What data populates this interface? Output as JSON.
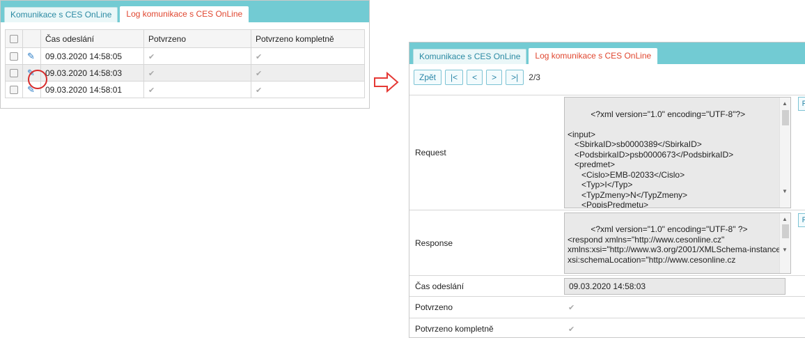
{
  "left_panel": {
    "tabs": [
      {
        "label": "Komunikace s CES OnLine",
        "active": false
      },
      {
        "label": "Log komunikace s CES OnLine",
        "active": true
      }
    ],
    "columns": [
      "",
      "",
      "Čas odeslání",
      "Potvrzeno",
      "Potvrzeno kompletně"
    ],
    "rows": [
      {
        "time": "09.03.2020 14:58:05",
        "confirmed": true,
        "confirmed_complete": true,
        "selected": false
      },
      {
        "time": "09.03.2020 14:58:03",
        "confirmed": true,
        "confirmed_complete": true,
        "selected": true
      },
      {
        "time": "09.03.2020 14:58:01",
        "confirmed": true,
        "confirmed_complete": true,
        "selected": false
      }
    ]
  },
  "right_panel": {
    "tabs": [
      {
        "label": "Komunikace s CES OnLine",
        "active": false
      },
      {
        "label": "Log komunikace s CES OnLine",
        "active": true
      }
    ],
    "nav": {
      "back_label": "Zpět",
      "first_label": "|<",
      "prev_label": "<",
      "next_label": ">",
      "last_label": ">|",
      "page_info": "2/3"
    },
    "fields": {
      "request_label": "Request",
      "request_value": "<?xml version=\"1.0\" encoding=\"UTF-8\"?>\n\n<input>\n   <SbirkaID>sb0000389</SbirkaID>\n   <PodsbirkaID>psb0000673</PodsbirkaID>\n   <predmet>\n      <Cislo>EMB-02033</Cislo>\n      <Typ>I</Typ>\n      <TypZmeny>N</TypZmeny>\n      <PopisPredmetu>",
      "response_label": "Response",
      "response_value": "<?xml version=\"1.0\" encoding=\"UTF-8\" ?>\n<respond xmlns=\"http://www.cesonline.cz\" xmlns:xsi=\"http://www.w3.org/2001/XMLSchema-instance\"\nxsi:schemaLocation=\"http://www.cesonline.cz",
      "sent_time_label": "Čas odeslání",
      "sent_time_value": "09.03.2020 14:58:03",
      "confirmed_label": "Potvrzeno",
      "confirmed_value": true,
      "confirmed_complete_label": "Potvrzeno kompletně",
      "confirmed_complete_value": true,
      "format_button_label": "F"
    }
  },
  "icons": {
    "edit": "pencil-icon",
    "arrow": "right-arrow-icon",
    "check": "checkmark-icon"
  },
  "colors": {
    "tab_bar": "#72cbd3",
    "active_tab_text": "#e0462f",
    "inactive_tab_text": "#2b8aa3",
    "highlight_circle": "#d72b2b",
    "arrow": "#e53935"
  }
}
